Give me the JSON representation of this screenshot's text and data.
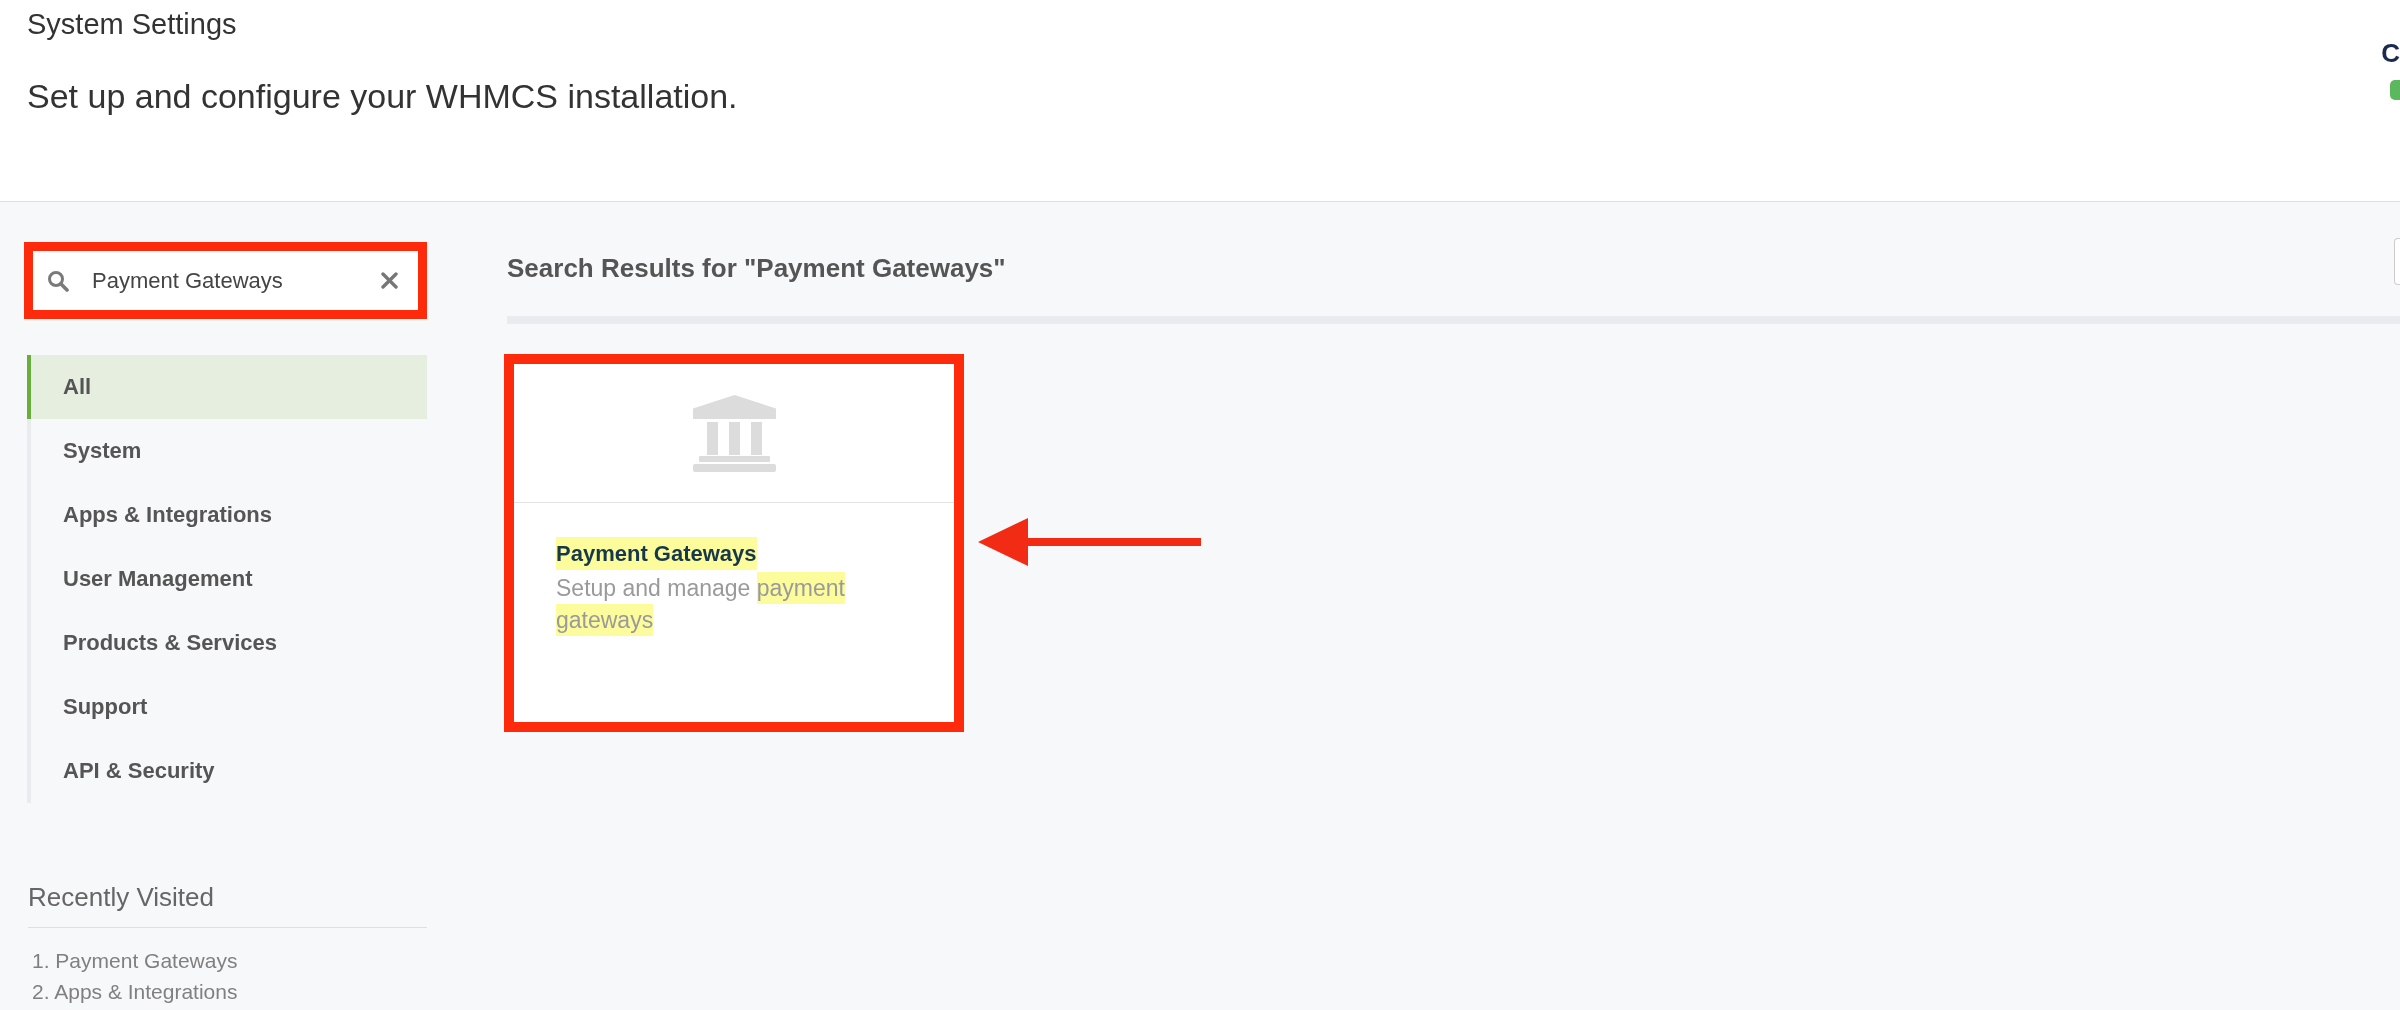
{
  "header": {
    "title": "System Settings",
    "subtitle": "Set up and configure your WHMCS installation.",
    "corner_text": "C"
  },
  "sidebar": {
    "search": {
      "value": "Payment Gateways",
      "annotated": true
    },
    "items": [
      {
        "label": "All",
        "selected": true
      },
      {
        "label": "System",
        "selected": false
      },
      {
        "label": "Apps & Integrations",
        "selected": false
      },
      {
        "label": "User Management",
        "selected": false
      },
      {
        "label": "Products & Services",
        "selected": false
      },
      {
        "label": "Support",
        "selected": false
      },
      {
        "label": "API & Security",
        "selected": false
      }
    ],
    "recent": {
      "title": "Recently Visited",
      "items": [
        "1. Payment Gateways",
        "2. Apps & Integrations"
      ]
    }
  },
  "results": {
    "heading": "Search Results for \"Payment Gateways\"",
    "cards": [
      {
        "title": "Payment Gateways",
        "title_highlighted": true,
        "description": [
          {
            "text": "Setup and manage ",
            "highlighted": false
          },
          {
            "text": "payment gateways",
            "highlighted": true
          }
        ],
        "annotated": true,
        "pointed_at": true
      }
    ]
  }
}
